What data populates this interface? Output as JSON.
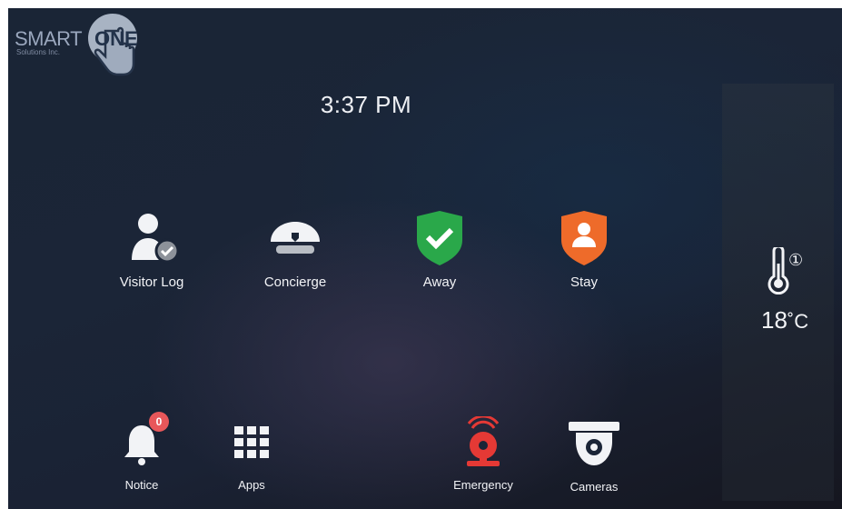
{
  "app": {
    "logo_text": "SMART",
    "logo_text_bold": "ONE",
    "logo_subtitle": "Solutions Inc."
  },
  "clock": {
    "time": "3:37 PM"
  },
  "tiles": [
    {
      "label": "Visitor Log",
      "icon": "visitor-check-icon"
    },
    {
      "label": "Concierge",
      "icon": "concierge-cap-icon"
    },
    {
      "label": "Away",
      "icon": "shield-check-icon"
    },
    {
      "label": "Stay",
      "icon": "shield-person-icon"
    }
  ],
  "bottom": [
    {
      "label": "Notice",
      "icon": "bell-icon",
      "badge": "0"
    },
    {
      "label": "Apps",
      "icon": "grid-icon"
    },
    {
      "label": "Emergency",
      "icon": "alarm-bell-icon"
    },
    {
      "label": "Cameras",
      "icon": "dome-camera-icon"
    }
  ],
  "weather": {
    "temperature": "18",
    "unit": "˚C",
    "sensor_index": "①",
    "icon": "thermometer-icon"
  },
  "colors": {
    "away": "#2aa84a",
    "stay": "#ee6b2a",
    "emergency": "#e53935",
    "badge": "#e8575a"
  }
}
